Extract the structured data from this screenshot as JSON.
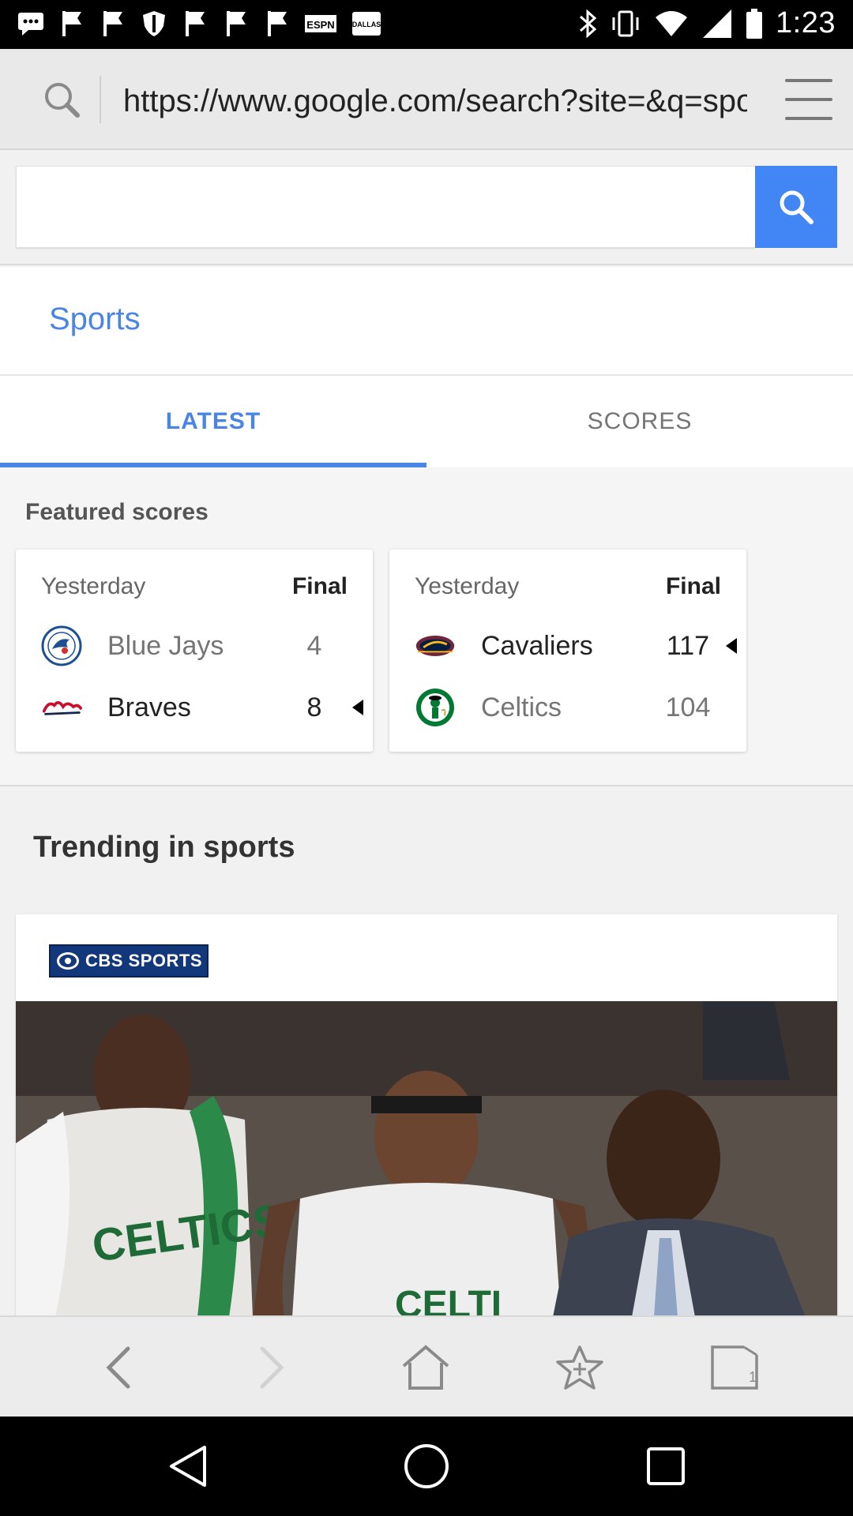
{
  "status_bar": {
    "time": "1:23",
    "icons": [
      "messaging-icon",
      "flag-icon",
      "flag-icon",
      "shield-icon",
      "flag-icon",
      "flag-icon",
      "flag-icon",
      "espn-icon",
      "dallas-icon",
      "bluetooth-icon",
      "vibrate-icon",
      "wifi-icon",
      "signal-icon",
      "battery-icon"
    ],
    "icon_texts": {
      "espn": "ESPN",
      "dallas": "DALLAS"
    }
  },
  "address_bar": {
    "url": "https://www.google.com/search?site=&q=sports"
  },
  "search": {
    "value": "",
    "placeholder": "",
    "button_color": "#4285f4"
  },
  "sports": {
    "title": "Sports"
  },
  "tabs": {
    "latest": "LATEST",
    "scores": "SCORES",
    "active": "latest",
    "accent_color": "#4a85e6"
  },
  "featured": {
    "title": "Featured scores",
    "games": [
      {
        "date": "Yesterday",
        "status": "Final",
        "teams": [
          {
            "name": "Blue Jays",
            "score": "4",
            "winner": false
          },
          {
            "name": "Braves",
            "score": "8",
            "winner": true
          }
        ]
      },
      {
        "date": "Yesterday",
        "status": "Final",
        "teams": [
          {
            "name": "Cavaliers",
            "score": "117",
            "winner": true
          },
          {
            "name": "Celtics",
            "score": "104",
            "winner": false
          }
        ]
      }
    ]
  },
  "trending": {
    "title": "Trending in sports",
    "source_logo": "CBS SPORTS"
  },
  "bottom_nav": {
    "tab_count": "1"
  }
}
